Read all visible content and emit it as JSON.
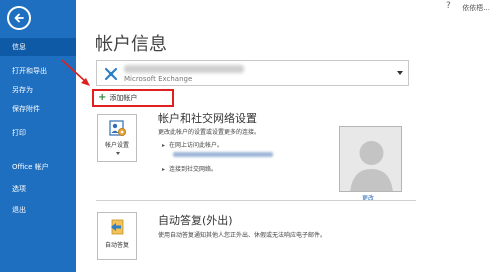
{
  "user": {
    "name": "依依梧..."
  },
  "window_controls": {
    "minimize": "?",
    "close": "✕"
  },
  "sidebar": {
    "back_icon": "back-arrow-icon",
    "items": [
      {
        "label": "信息",
        "active": true
      },
      {
        "label": "打开和导出"
      },
      {
        "label": "另存为"
      },
      {
        "label": "保存附件"
      },
      {
        "label": "打印"
      },
      {
        "label": "Office 帐户"
      },
      {
        "label": "选项"
      },
      {
        "label": "退出"
      }
    ]
  },
  "main": {
    "title": "帐户信息",
    "account": {
      "type": "Microsoft Exchange",
      "icon": "exchange-icon"
    },
    "add_account": {
      "label": "添加帐户",
      "icon": "plus-icon"
    },
    "account_settings": {
      "tile_label": "帐户设置",
      "title": "帐户和社交网络设置",
      "description": "更改此帐户的设置或设置更多的连接。",
      "bullets": [
        "在网上访问此帐户。",
        "连接到社交网络。"
      ]
    },
    "profile": {
      "change_label": "更改"
    },
    "auto_reply": {
      "tile_label": "自动答复",
      "title": "自动答复(外出)",
      "description": "使用自动答复通知其他人您正外出、休假或无法响应电子邮件。"
    }
  },
  "colors": {
    "sidebar": "#1e6fbf",
    "sidebar_active": "#0f5aa6",
    "highlight_box": "#e0201f",
    "link": "#2a6ebb"
  }
}
